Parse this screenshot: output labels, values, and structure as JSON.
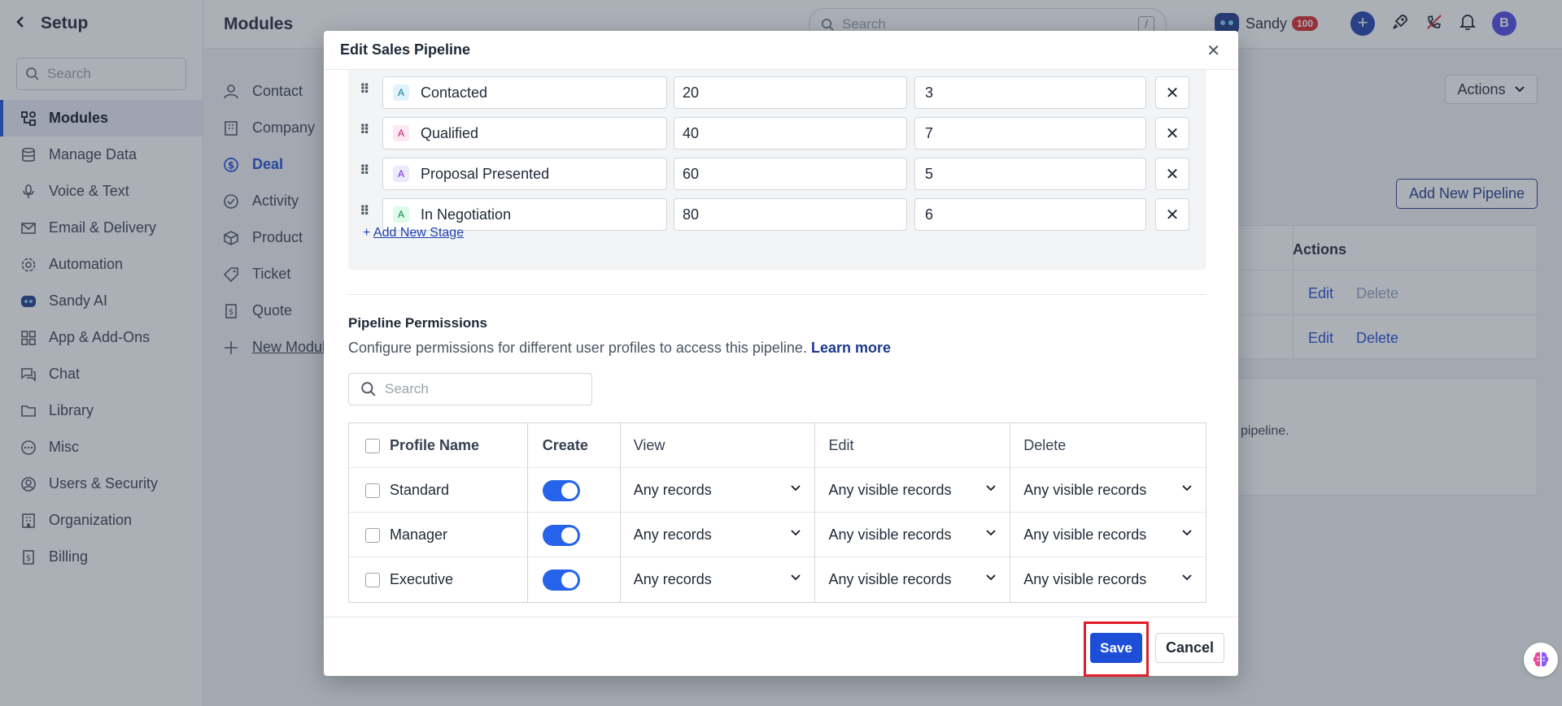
{
  "sidebar": {
    "title": "Setup",
    "search_placeholder": "Search",
    "items": [
      {
        "label": "Modules",
        "icon": "modules-icon"
      },
      {
        "label": "Manage Data",
        "icon": "database-icon"
      },
      {
        "label": "Voice & Text",
        "icon": "microphone-icon"
      },
      {
        "label": "Email & Delivery",
        "icon": "mail-icon"
      },
      {
        "label": "Automation",
        "icon": "automation-icon"
      },
      {
        "label": "Sandy AI",
        "icon": "bot-icon"
      },
      {
        "label": "App & Add-Ons",
        "icon": "apps-icon"
      },
      {
        "label": "Chat",
        "icon": "chat-icon"
      },
      {
        "label": "Library",
        "icon": "folder-icon"
      },
      {
        "label": "Misc",
        "icon": "ellipsis-icon"
      },
      {
        "label": "Users & Security",
        "icon": "user-circle-icon"
      },
      {
        "label": "Organization",
        "icon": "building-icon"
      },
      {
        "label": "Billing",
        "icon": "billing-icon"
      }
    ]
  },
  "topbar": {
    "page_title": "Modules",
    "search_placeholder": "Search",
    "search_shortcut": "/",
    "user_name": "Sandy",
    "user_badge": "100",
    "avatar_initial": "B"
  },
  "modules": [
    {
      "label": "Contact"
    },
    {
      "label": "Company"
    },
    {
      "label": "Deal"
    },
    {
      "label": "Activity"
    },
    {
      "label": "Product"
    },
    {
      "label": "Ticket"
    },
    {
      "label": "Quote"
    },
    {
      "label": "New Modul"
    }
  ],
  "background": {
    "actions_button": "Actions",
    "add_pipeline_button": "Add New Pipeline",
    "table_header_actions": "Actions",
    "row1_edit": "Edit",
    "row1_delete": "Delete",
    "row2_edit": "Edit",
    "row2_delete": "Delete",
    "info_text": "pipeline."
  },
  "modal": {
    "title": "Edit Sales Pipeline",
    "stages": [
      {
        "letter": "A",
        "name": "Contacted",
        "probability": "20",
        "days": "3",
        "letter_bg": "#e0f2fe",
        "letter_color": "#0e7490"
      },
      {
        "letter": "A",
        "name": "Qualified",
        "probability": "40",
        "days": "7",
        "letter_bg": "#fce7f3",
        "letter_color": "#be185d"
      },
      {
        "letter": "A",
        "name": "Proposal Presented",
        "probability": "60",
        "days": "5",
        "letter_bg": "#ede9fe",
        "letter_color": "#6d28d9"
      },
      {
        "letter": "A",
        "name": "In Negotiation",
        "probability": "80",
        "days": "6",
        "letter_bg": "#dcfce7",
        "letter_color": "#15803d"
      }
    ],
    "add_stage_label": "Add New Stage",
    "permissions": {
      "title": "Pipeline Permissions",
      "description": "Configure permissions for different user profiles to access this pipeline.",
      "learn_more": "Learn more",
      "search_placeholder": "Search",
      "headers": {
        "profile": "Profile Name",
        "create": "Create",
        "view": "View",
        "edit": "Edit",
        "delete": "Delete"
      },
      "rows": [
        {
          "profile": "Standard",
          "view": "Any records",
          "edit": "Any visible records",
          "delete": "Any visible records"
        },
        {
          "profile": "Manager",
          "view": "Any records",
          "edit": "Any visible records",
          "delete": "Any visible records"
        },
        {
          "profile": "Executive",
          "view": "Any records",
          "edit": "Any visible records",
          "delete": "Any visible records"
        }
      ]
    },
    "save_label": "Save",
    "cancel_label": "Cancel"
  }
}
